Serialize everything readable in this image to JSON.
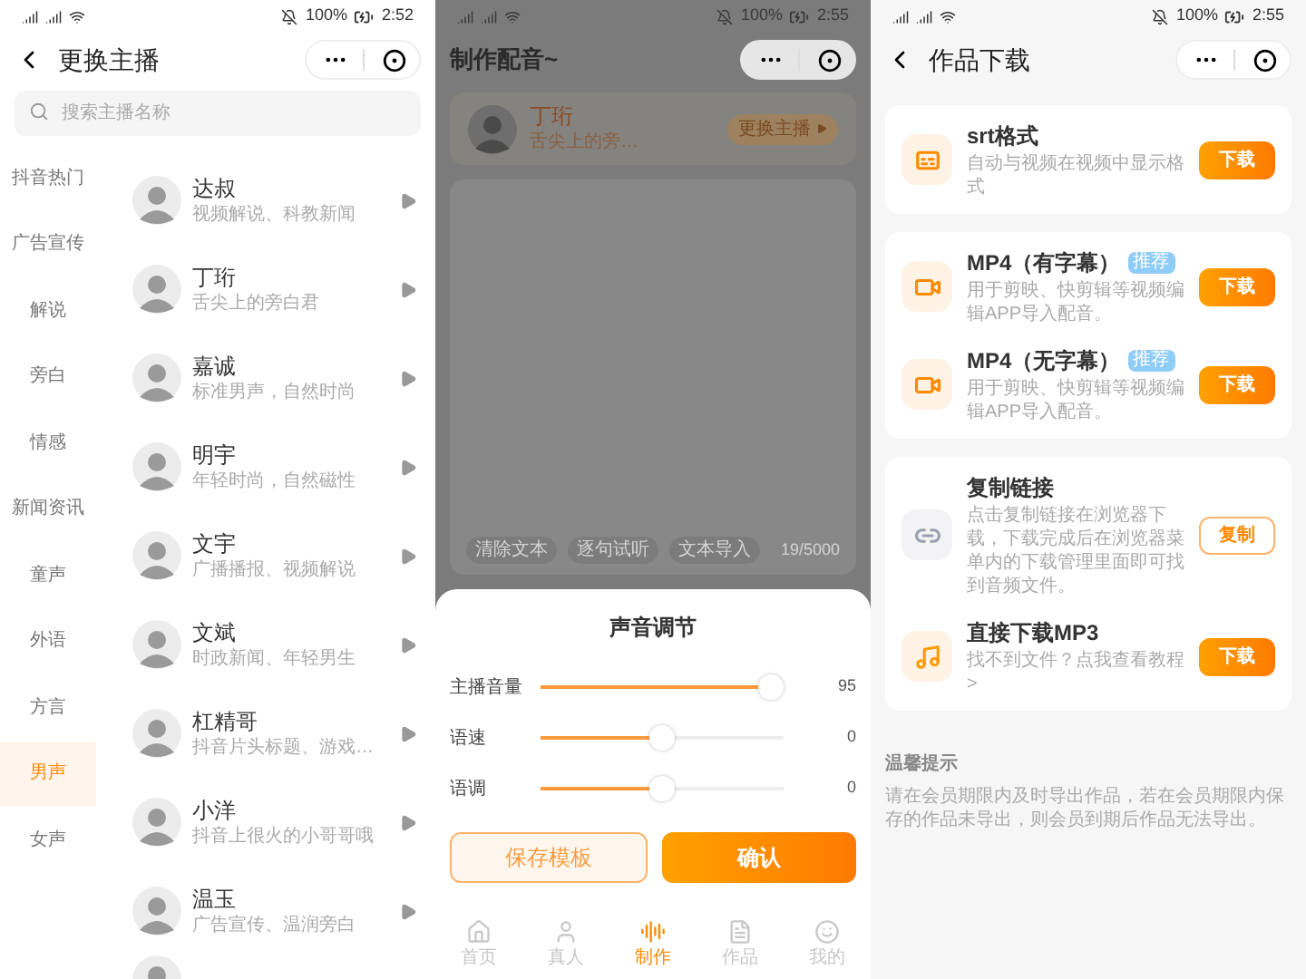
{
  "anchor_screen": {
    "status_bar": {
      "battery": "100%",
      "time": "2:52"
    },
    "title": "更换主播",
    "search": {
      "placeholder": "搜索主播名称"
    },
    "categories": [
      {
        "label": "抖音热门",
        "selected": false
      },
      {
        "label": "广告宣传",
        "selected": false
      },
      {
        "label": "解说",
        "selected": false
      },
      {
        "label": "旁白",
        "selected": false
      },
      {
        "label": "情感",
        "selected": false
      },
      {
        "label": "新闻资讯",
        "selected": false
      },
      {
        "label": "童声",
        "selected": false
      },
      {
        "label": "外语",
        "selected": false
      },
      {
        "label": "方言",
        "selected": false
      },
      {
        "label": "男声",
        "selected": true
      },
      {
        "label": "女声",
        "selected": false
      }
    ],
    "anchors": [
      {
        "name": "达叔",
        "desc": "视频解说、科教新闻"
      },
      {
        "name": "丁珩",
        "desc": "舌尖上的旁白君"
      },
      {
        "name": "嘉诚",
        "desc": "标准男声，自然时尚"
      },
      {
        "name": "明宇",
        "desc": "年轻时尚，自然磁性"
      },
      {
        "name": "文宇",
        "desc": "广播播报、视频解说"
      },
      {
        "name": "文斌",
        "desc": "时政新闻、年轻男生"
      },
      {
        "name": "杠精哥",
        "desc": "抖音片头标题、游戏…"
      },
      {
        "name": "小洋",
        "desc": "抖音上很火的小哥哥哦"
      },
      {
        "name": "温玉",
        "desc": "广告宣传、温润旁白"
      }
    ]
  },
  "dubbing_screen": {
    "status_bar": {
      "battery": "100%",
      "time": "2:55"
    },
    "title": "制作配音~",
    "current_anchor": {
      "name": "丁珩",
      "desc": "舌尖上的旁…",
      "change_button": "更换主播"
    },
    "text_tools": [
      "清除文本",
      "逐句试听",
      "文本导入"
    ],
    "char_count": "19/5000",
    "sheet": {
      "title": "声音调节",
      "sliders": [
        {
          "label": "主播音量",
          "level": 0.95,
          "reading": "95"
        },
        {
          "label": "语速",
          "level": 0.5,
          "reading": "0"
        },
        {
          "label": "语调",
          "level": 0.5,
          "reading": "0"
        }
      ],
      "save_button": "保存模板",
      "confirm_button": "确认"
    },
    "tabs": [
      {
        "label": "首页",
        "kind": "home",
        "selected": false
      },
      {
        "label": "真人",
        "kind": "person",
        "selected": false
      },
      {
        "label": "制作",
        "kind": "make",
        "selected": true
      },
      {
        "label": "作品",
        "kind": "works",
        "selected": false
      },
      {
        "label": "我的",
        "kind": "me",
        "selected": false
      }
    ]
  },
  "download_screen": {
    "status_bar": {
      "battery": "100%",
      "time": "2:55"
    },
    "title": "作品下载",
    "groups": [
      {
        "items": [
          {
            "kind": "srt",
            "title": "srt格式",
            "desc": "自动与视频在视频中显示格式",
            "button": {
              "label": "下载"
            }
          }
        ]
      },
      {
        "items": [
          {
            "kind": "video_sub",
            "title": "MP4（有字幕）",
            "badge": "推荐",
            "desc": "用于剪映、快剪辑等视频编辑APP导入配音。",
            "button": {
              "label": "下载"
            }
          },
          {
            "kind": "video_nosub",
            "title": "MP4（无字幕）",
            "badge": "推荐",
            "desc": "用于剪映、快剪辑等视频编辑APP导入配音。",
            "button": {
              "label": "下载"
            }
          }
        ]
      },
      {
        "items": [
          {
            "kind": "link",
            "title": "复制链接",
            "desc": "点击复制链接在浏览器下载，下载完成后在浏览器菜单内的下载管理里面即可找到音频文件。",
            "button": {
              "label": "复制"
            }
          },
          {
            "kind": "mp3",
            "title": "直接下载MP3",
            "desc": "找不到文件？点我查看教程>",
            "button": {
              "label": "下载"
            }
          }
        ]
      }
    ],
    "tips": {
      "title": "温馨提示",
      "text": "请在会员期限内及时导出作品，若在会员期限内保存的作品未导出，则会员到期后作品无法导出。"
    }
  }
}
